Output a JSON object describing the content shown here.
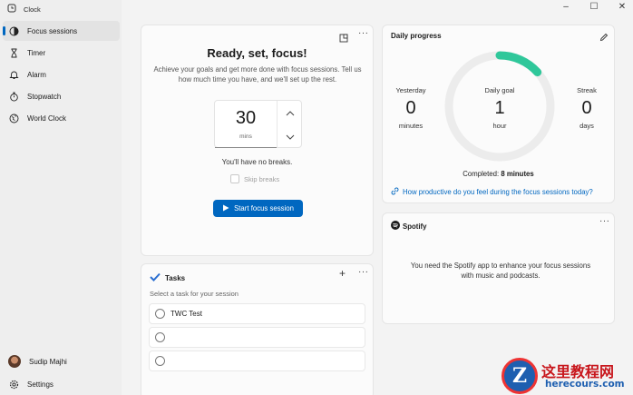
{
  "app": {
    "title": "Clock"
  },
  "sidebar": {
    "items": [
      {
        "label": "Focus sessions",
        "icon": "focus-icon",
        "active": true
      },
      {
        "label": "Timer",
        "icon": "hourglass-icon"
      },
      {
        "label": "Alarm",
        "icon": "alarm-icon"
      },
      {
        "label": "Stopwatch",
        "icon": "stopwatch-icon"
      },
      {
        "label": "World Clock",
        "icon": "globe-icon"
      }
    ],
    "user": {
      "name": "Sudip Majhi"
    },
    "settings_label": "Settings"
  },
  "window_controls": {
    "minimize": "–",
    "maximize": "☐",
    "close": "✕"
  },
  "focus": {
    "title": "Ready, set, focus!",
    "description": "Achieve your goals and get more done with focus sessions. Tell us how much time you have, and we'll set up the rest.",
    "timer_value": "30",
    "timer_unit": "mins",
    "breaks_text": "You'll have no breaks.",
    "skip_breaks_label": "Skip breaks",
    "start_label": "Start focus session"
  },
  "daily_progress": {
    "title": "Daily progress",
    "yesterday": {
      "label": "Yesterday",
      "value": "0",
      "unit": "minutes"
    },
    "goal": {
      "label": "Daily goal",
      "value": "1",
      "unit": "hour"
    },
    "streak": {
      "label": "Streak",
      "value": "0",
      "unit": "days"
    },
    "completed_label": "Completed:",
    "completed_value": "8 minutes",
    "progress_fraction": 0.1333,
    "link_text": "How productive do you feel during the focus sessions today?"
  },
  "spotify": {
    "title": "Spotify",
    "message": "You need the Spotify app to enhance your focus sessions with music and podcasts."
  },
  "tasks": {
    "title": "Tasks",
    "prompt": "Select a task for your session",
    "items": [
      "TWC Test",
      "",
      ""
    ]
  },
  "watermark": {
    "cn": "这里教程网",
    "url": "herecours.com"
  },
  "colors": {
    "accent": "#0067c0",
    "progress": "#2fc79a",
    "ring": "#ececec"
  }
}
